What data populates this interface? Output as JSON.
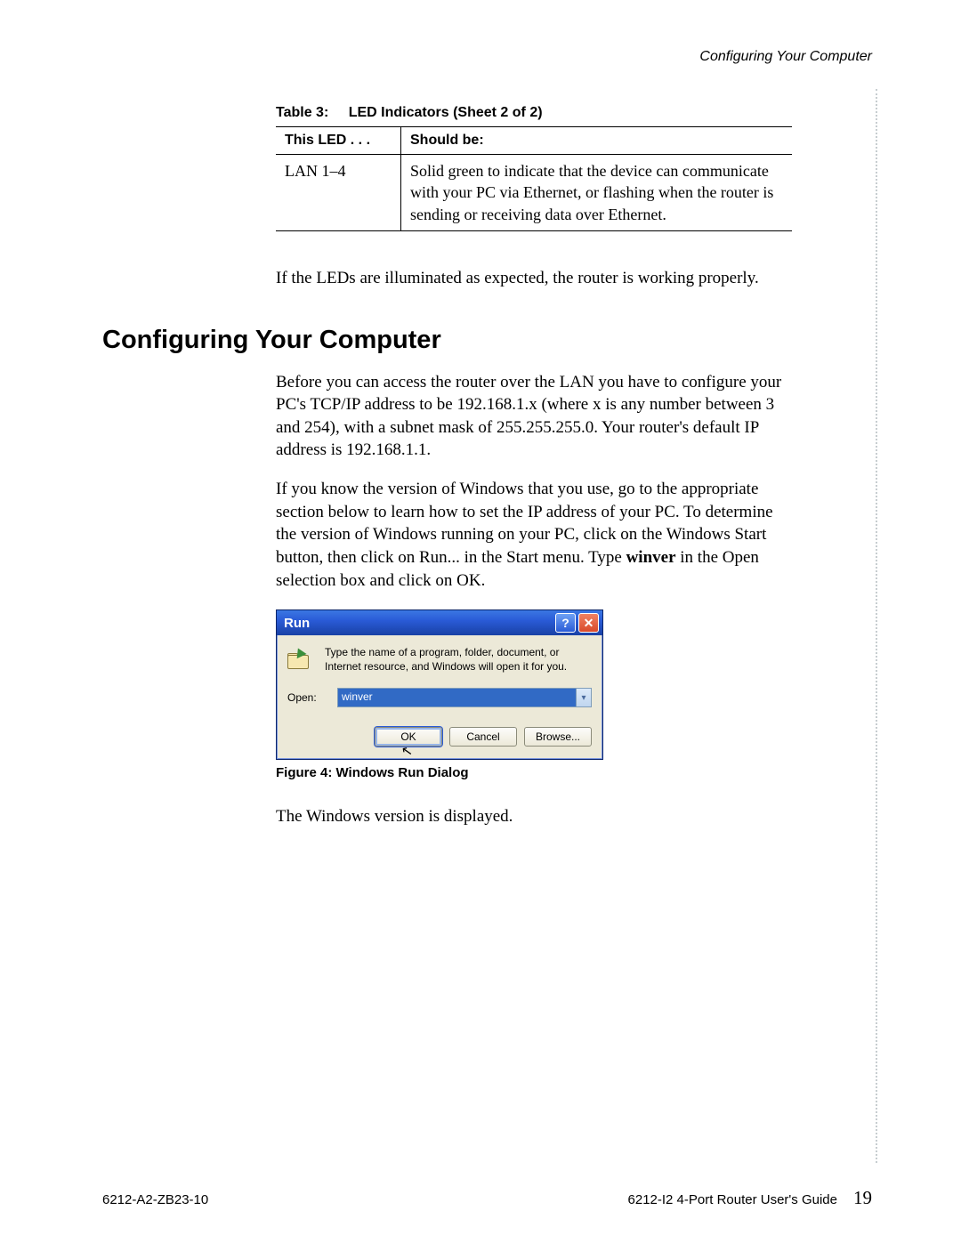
{
  "header": {
    "running_title": "Configuring Your Computer"
  },
  "table": {
    "caption_label": "Table 3:",
    "caption_text": "LED Indicators (Sheet 2 of 2)",
    "head_col1": "This LED . . .",
    "head_col2": "Should be:",
    "row1_col1": "LAN 1–4",
    "row1_col2": "Solid green to indicate that the device can communicate with your PC via Ethernet, or flashing when the router is sending or receiving data over Ethernet."
  },
  "para_after_table": "If the LEDs are illuminated as expected, the router is working properly.",
  "section_heading": "Configuring Your Computer",
  "para1": "Before you can access the router over the LAN you have to configure your PC's TCP/IP address to be 192.168.1.x (where x is any number between 3 and 254), with a subnet mask of 255.255.255.0. Your router's default IP address is 192.168.1.1.",
  "para2_pre": "If you know the version of Windows that you use, go to the appropriate section below to learn how to set the IP address of your PC. To determine the version of Windows running on your PC, click on the Windows Start button, then click on Run... in the Start menu. Type ",
  "para2_bold": "winver",
  "para2_post": " in the Open selection box and click on OK.",
  "run_dialog": {
    "title": "Run",
    "help_symbol": "?",
    "close_symbol": "✕",
    "description": "Type the name of a program, folder, document, or Internet resource, and Windows will open it for you.",
    "open_label": "Open:",
    "input_value": "winver",
    "dropdown_symbol": "▾",
    "ok": "OK",
    "cancel": "Cancel",
    "browse": "Browse...",
    "cursor_symbol": "↖"
  },
  "figure_caption": "Figure 4: Windows Run Dialog",
  "para3": "The Windows version is displayed.",
  "footer": {
    "left": "6212-A2-ZB23-10",
    "right": "6212-I2 4-Port Router User's Guide",
    "page": "19"
  }
}
